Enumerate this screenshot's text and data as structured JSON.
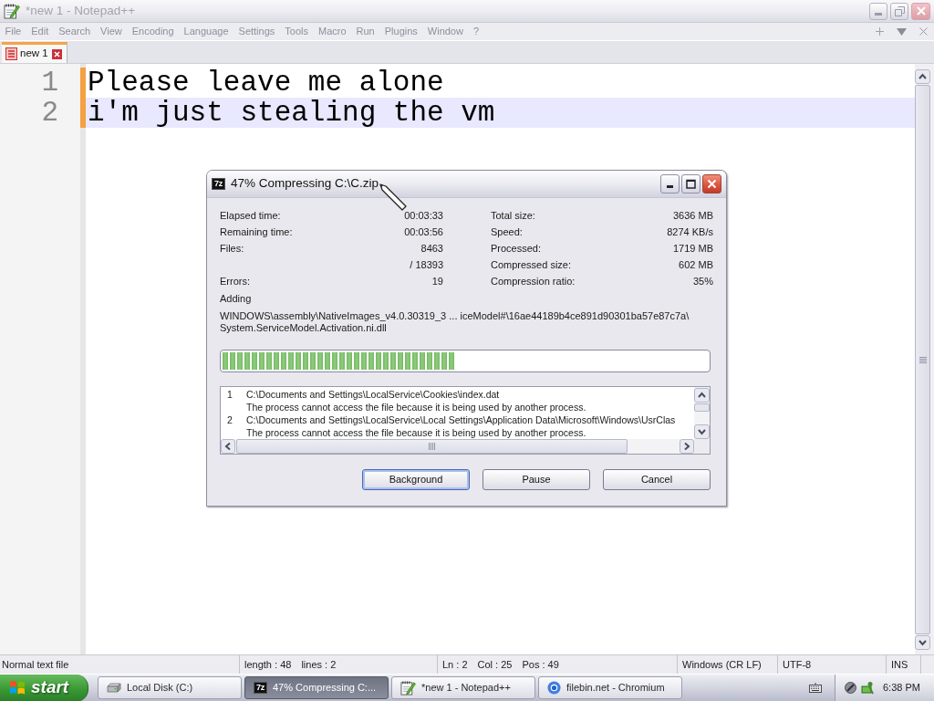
{
  "window": {
    "title": "*new 1 - Notepad++",
    "active": false
  },
  "menu": [
    "File",
    "Edit",
    "Search",
    "View",
    "Encoding",
    "Language",
    "Settings",
    "Tools",
    "Macro",
    "Run",
    "Plugins",
    "Window",
    "?"
  ],
  "tabs": [
    {
      "label": "new 1",
      "selected": true,
      "unsaved": true
    }
  ],
  "editor": {
    "lines": [
      {
        "number": "1",
        "text": "Please leave me alone",
        "current": false,
        "modified": true
      },
      {
        "number": "2",
        "text": "i'm just stealing the vm",
        "current": true,
        "modified": true
      }
    ]
  },
  "dialog": {
    "logo": "7z",
    "title": "47% Compressing C:\\C.zip",
    "stats_left": [
      {
        "label": "Elapsed time:",
        "value": "00:03:33"
      },
      {
        "label": "Remaining time:",
        "value": "00:03:56"
      },
      {
        "label": "Files:",
        "value": "8463"
      },
      {
        "value": "/ 18393"
      },
      {
        "label": "Errors:",
        "value": "19"
      }
    ],
    "stats_right": [
      {
        "label": "Total size:",
        "value": "3636 MB"
      },
      {
        "label": "Speed:",
        "value": "8274 KB/s"
      },
      {
        "label": "Processed:",
        "value": "1719 MB"
      },
      {
        "label": "Compressed size:",
        "value": "602 MB"
      },
      {
        "label": "Compression ratio:",
        "value": "35%"
      }
    ],
    "operation": "Adding",
    "current_file": [
      "WINDOWS\\assembly\\NativeImages_v4.0.30319_3 ... iceModel#\\16ae44189b4ce891d90301ba57e87c7a\\",
      "System.ServiceModel.Activation.ni.dll"
    ],
    "progress": {
      "level": 0.48
    },
    "log": [
      {
        "number": "1",
        "path": "C:\\Documents and Settings\\LocalService\\Cookies\\index.dat",
        "message": "The process cannot access the file because it is being used by another process."
      },
      {
        "number": "2",
        "path": "C:\\Documents and Settings\\LocalService\\Local Settings\\Application Data\\Microsoft\\Windows\\UsrClas",
        "message": "The process cannot access the file because it is being used by another process."
      }
    ],
    "buttons": [
      {
        "label": "Background",
        "focused": true
      },
      {
        "label": "Pause",
        "focused": false
      },
      {
        "label": "Cancel",
        "focused": false
      }
    ]
  },
  "status_bar": [
    {
      "items": [
        "Normal text file"
      ]
    },
    {
      "items": [
        "length : 48",
        "lines : 2"
      ]
    },
    {
      "items": [
        "Ln : 2",
        "Col : 25",
        "Pos : 49"
      ]
    },
    {
      "items": [
        "Windows (CR LF)"
      ]
    },
    {
      "items": [
        "UTF-8"
      ]
    },
    {
      "items": [
        "INS"
      ]
    }
  ],
  "taskbar": {
    "start": "start",
    "tasks": [
      {
        "kind": "drive",
        "label": "Local Disk (C:)",
        "selected": false
      },
      {
        "kind": "archiver",
        "logo": "7z",
        "label": "47% Compressing C:...",
        "selected": true
      },
      {
        "kind": "notepad",
        "label": "*new 1 - Notepad++",
        "selected": false
      },
      {
        "kind": "browser",
        "label": "filebin.net - Chromium",
        "selected": false
      }
    ],
    "clock": "6:38 PM"
  }
}
